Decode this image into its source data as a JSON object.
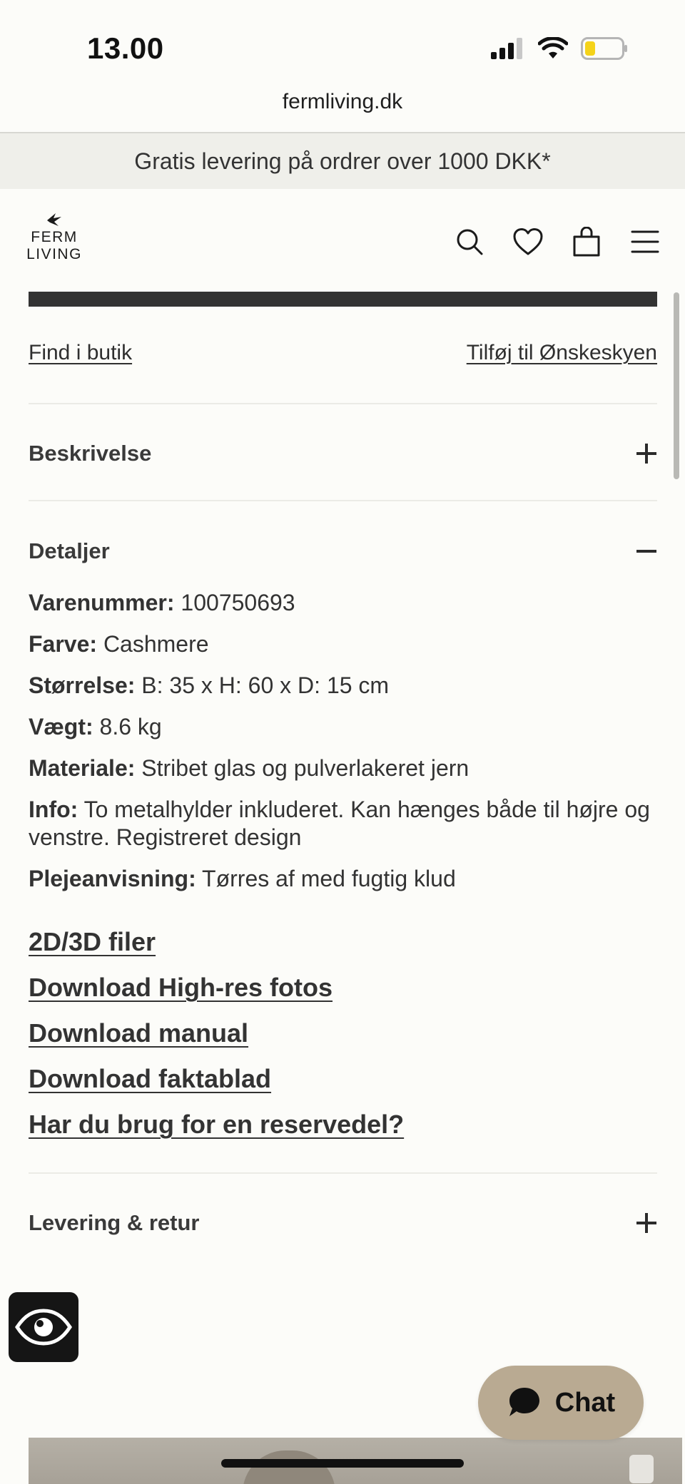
{
  "status_bar": {
    "time": "13.00"
  },
  "browser": {
    "url": "fermliving.dk"
  },
  "promo": {
    "text": "Gratis levering på ordrer over 1000 DKK*"
  },
  "header": {
    "logo_line1": "FERM",
    "logo_line2": "LIVING"
  },
  "actions": {
    "find_store": "Find i butik",
    "add_wishlist": "Tilføj til Ønskeskyen"
  },
  "accordions": {
    "description": {
      "title": "Beskrivelse",
      "state": "collapsed"
    },
    "details": {
      "title": "Detaljer",
      "state": "expanded"
    },
    "delivery": {
      "title": "Levering & retur",
      "state": "collapsed"
    }
  },
  "details": {
    "item_number": {
      "label": "Varenummer:",
      "value": "100750693"
    },
    "color": {
      "label": "Farve:",
      "value": "Cashmere"
    },
    "size": {
      "label": "Størrelse:",
      "value": "B: 35 x H: 60 x D: 15 cm"
    },
    "weight": {
      "label": "Vægt:",
      "value": "8.6 kg"
    },
    "material": {
      "label": "Materiale:",
      "value": "Stribet glas og pulverlakeret jern"
    },
    "info": {
      "label": "Info:",
      "value": "To metalhylder inkluderet. Kan hænges både til højre og venstre. Registreret design"
    },
    "care": {
      "label": "Plejeanvisning:",
      "value": "Tørres af med fugtig klud"
    }
  },
  "resources": {
    "files_2d3d": "2D/3D filer",
    "hires_photos": "Download High-res fotos",
    "manual": "Download manual",
    "factsheet": "Download faktablad",
    "spare_part": "Har du brug for en reservedel?"
  },
  "chat": {
    "label": "Chat"
  },
  "colors": {
    "background": "#fcfcf9",
    "promo_bg": "#efefea",
    "chat_bg": "#b9aa92",
    "text": "#2b2b2b",
    "battery": "#f5d31a"
  },
  "icons": [
    "signal-icon",
    "wifi-icon",
    "battery-icon",
    "logo-bird-icon",
    "search-icon",
    "heart-icon",
    "bag-icon",
    "menu-icon",
    "plus-icon",
    "minus-icon",
    "eye-icon",
    "chat-bubble-icon"
  ]
}
